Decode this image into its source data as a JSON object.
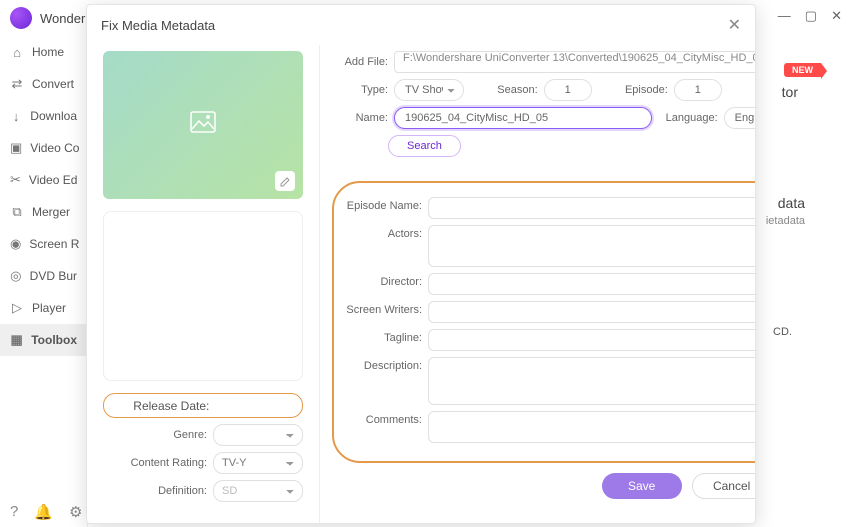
{
  "app": {
    "title": "Wonder"
  },
  "window_controls": {
    "min": "—",
    "max": "▢",
    "close": "✕"
  },
  "sidebar": {
    "items": [
      {
        "icon": "⌂",
        "label": "Home"
      },
      {
        "icon": "⇄",
        "label": "Convert"
      },
      {
        "icon": "↓",
        "label": "Downloa"
      },
      {
        "icon": "▣",
        "label": "Video Co"
      },
      {
        "icon": "✂",
        "label": "Video Ed"
      },
      {
        "icon": "⧉",
        "label": "Merger"
      },
      {
        "icon": "◉",
        "label": "Screen R"
      },
      {
        "icon": "◎",
        "label": "DVD Bur"
      },
      {
        "icon": "▷",
        "label": "Player"
      },
      {
        "icon": "▦",
        "label": "Toolbox"
      }
    ],
    "bottom_icons": [
      "?",
      "🔔",
      "⚙"
    ]
  },
  "bg_hints": {
    "badge": "NEW",
    "t1": "tor",
    "t2": "data",
    "t3": "ietadata",
    "t4": "CD."
  },
  "modal": {
    "title": "Fix Media Metadata",
    "close": "✕",
    "left": {
      "release_date_label": "Release Date:",
      "release_date_value": "",
      "genre_label": "Genre:",
      "genre_value": "",
      "content_rating_label": "Content Rating:",
      "content_rating_value": "TV-Y",
      "definition_label": "Definition:",
      "definition_value": "SD"
    },
    "right": {
      "addfile_label": "Add File:",
      "addfile_path": "F:\\Wondershare UniConverter 13\\Converted\\190625_04_CityMisc_HD_0",
      "type_label": "Type:",
      "type_value": "TV Shows",
      "season_label": "Season:",
      "season_value": "1",
      "episode_label": "Episode:",
      "episode_value": "1",
      "name_label": "Name:",
      "name_value": "190625_04_CityMisc_HD_05",
      "language_label": "Language:",
      "language_value": "English",
      "search_label": "Search",
      "episode_name_label": "Episode Name:",
      "episode_name_value": "",
      "actors_label": "Actors:",
      "actors_value": "",
      "director_label": "Director:",
      "director_value": "",
      "screen_writers_label": "Screen Writers:",
      "screen_writers_value": "",
      "tagline_label": "Tagline:",
      "tagline_value": "",
      "description_label": "Description:",
      "description_value": "",
      "comments_label": "Comments:",
      "comments_value": ""
    },
    "footer": {
      "save": "Save",
      "cancel": "Cancel"
    }
  }
}
